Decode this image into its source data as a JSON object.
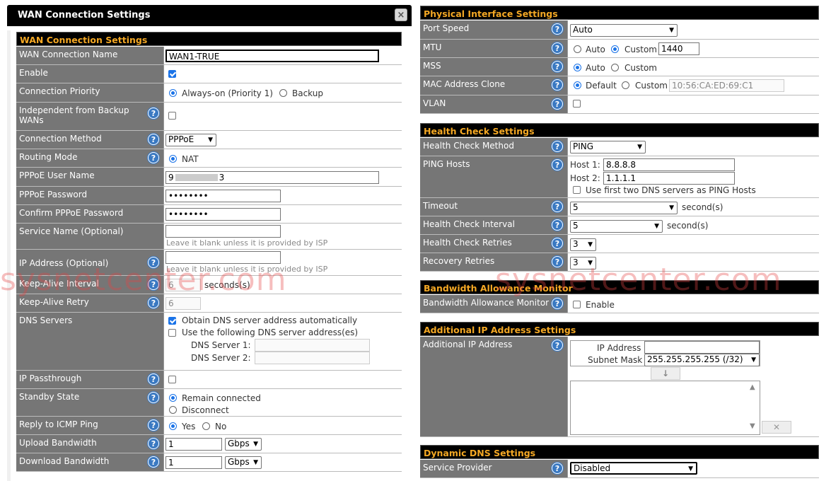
{
  "dialog": {
    "title": "WAN Connection Settings",
    "close": "×"
  },
  "wan": {
    "header": "WAN Connection Settings",
    "name_label": "WAN Connection Name",
    "name_value": "WAN1-TRUE",
    "enable_label": "Enable",
    "priority_label": "Connection Priority",
    "priority_opt1": "Always-on (Priority 1)",
    "priority_opt2": "Backup",
    "indep_label": "Independent from Backup WANs",
    "method_label": "Connection Method",
    "method_value": "PPPoE",
    "routing_label": "Routing Mode",
    "routing_value": "NAT",
    "user_label": "PPPoE User Name",
    "user_value_a": "9",
    "user_value_b": "3",
    "pass_label": "PPPoE Password",
    "pass_value": "••••••••",
    "confirm_label": "Confirm PPPoE Password",
    "confirm_value": "••••••••",
    "service_label": "Service Name (Optional)",
    "service_note": "Leave it blank unless it is provided by ISP",
    "ip_label": "IP Address (Optional)",
    "ip_note": "Leave it blank unless it is provided by ISP",
    "keepalive_label": "Keep-Alive Interval",
    "keepalive_value": "6",
    "keepalive_unit": "seconds(s)",
    "retry_label": "Keep-Alive Retry",
    "retry_value": "6",
    "dns_label": "DNS Servers",
    "dns_auto": "Obtain DNS server address automatically",
    "dns_manual": "Use the following DNS server address(es)",
    "dns1_label": "DNS Server 1:",
    "dns2_label": "DNS Server 2:",
    "passthrough_label": "IP Passthrough",
    "standby_label": "Standby State",
    "standby_opt1": "Remain connected",
    "standby_opt2": "Disconnect",
    "icmp_label": "Reply to ICMP Ping",
    "icmp_yes": "Yes",
    "icmp_no": "No",
    "upload_label": "Upload Bandwidth",
    "upload_value": "1",
    "upload_unit": "Gbps",
    "download_label": "Download Bandwidth",
    "download_value": "1",
    "download_unit": "Gbps"
  },
  "phys": {
    "header": "Physical Interface Settings",
    "speed_label": "Port Speed",
    "speed_value": "Auto",
    "mtu_label": "MTU",
    "mtu_auto": "Auto",
    "mtu_custom": "Custom",
    "mtu_value": "1440",
    "mss_label": "MSS",
    "mss_auto": "Auto",
    "mss_custom": "Custom",
    "mac_label": "MAC Address Clone",
    "mac_default": "Default",
    "mac_custom": "Custom",
    "mac_value": "10:56:CA:ED:69:C1",
    "vlan_label": "VLAN"
  },
  "health": {
    "header": "Health Check Settings",
    "method_label": "Health Check Method",
    "method_value": "PING",
    "hosts_label": "PING Hosts",
    "host1_label": "Host 1:",
    "host1_value": "8.8.8.8",
    "host2_label": "Host 2:",
    "host2_value": "1.1.1.1",
    "use_dns_label": "Use first two DNS servers as PING Hosts",
    "timeout_label": "Timeout",
    "timeout_value": "5",
    "timeout_unit": "second(s)",
    "interval_label": "Health Check Interval",
    "interval_value": "5",
    "interval_unit": "second(s)",
    "retries_label": "Health Check Retries",
    "retries_value": "3",
    "recovery_label": "Recovery Retries",
    "recovery_value": "3"
  },
  "bam": {
    "header": "Bandwidth Allowance Monitor",
    "label": "Bandwidth Allowance Monitor",
    "enable": "Enable"
  },
  "addip": {
    "header": "Additional IP Address Settings",
    "label": "Additional IP Address",
    "ip_label": "IP Address",
    "mask_label": "Subnet Mask",
    "mask_value": "255.255.255.255 (/32)",
    "add_icon": "↓",
    "remove_icon": "✕"
  },
  "ddns": {
    "header": "Dynamic DNS Settings",
    "provider_label": "Service Provider",
    "provider_value": "Disabled"
  },
  "help_glyph": "?",
  "watermark": "sysnetcenter.com",
  "colors": {
    "accent": "#f4a824",
    "label_bg": "#767676",
    "help": "#3a79c2"
  }
}
